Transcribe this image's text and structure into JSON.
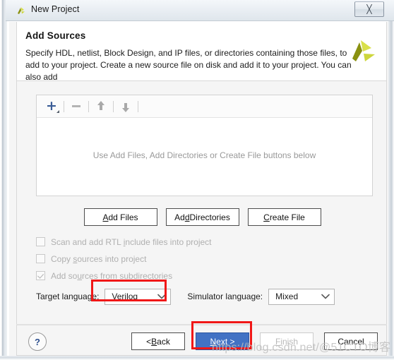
{
  "window": {
    "title": "New Project",
    "icon": "xilinx-logo-icon",
    "close_label": "✕"
  },
  "header": {
    "title": "Add Sources",
    "description": "Specify HDL, netlist, Block Design, and IP files, or directories containing those files, to add to your project. Create a new source file on disk and add it to your project. You can also add",
    "logo": "xilinx-logo"
  },
  "file_panel": {
    "toolbar": {
      "add_label": "+",
      "remove_label": "−",
      "move_up_label": "↑",
      "move_down_label": "↓"
    },
    "empty_message": "Use Add Files, Add Directories or Create File buttons below"
  },
  "action_buttons": [
    {
      "id": "add-files",
      "pre": "",
      "mnemonic": "A",
      "post": "dd Files"
    },
    {
      "id": "add-directories",
      "pre": "Ad",
      "mnemonic": "d",
      "post": " Directories"
    },
    {
      "id": "create-file",
      "pre": "",
      "mnemonic": "C",
      "post": "reate File"
    }
  ],
  "checkboxes": [
    {
      "id": "scan-rtl-include",
      "pre": "Scan and add RTL ",
      "mnemonic": "i",
      "post": "nclude files into project",
      "checked": false,
      "enabled": false
    },
    {
      "id": "copy-sources",
      "pre": "Copy ",
      "mnemonic": "s",
      "post": "ources into project",
      "checked": false,
      "enabled": false
    },
    {
      "id": "add-subdirectories",
      "pre": "Add so",
      "mnemonic": "u",
      "post": "rces from subdirectories",
      "checked": true,
      "enabled": false
    }
  ],
  "languages": {
    "target_label": "Target language:",
    "target_value": "Verilog",
    "simulator_label": "Simulator language:",
    "simulator_value": "Mixed"
  },
  "footer": {
    "help_label": "?",
    "buttons": [
      {
        "id": "back",
        "pre": "< ",
        "mnemonic": "B",
        "post": "ack",
        "style": "normal"
      },
      {
        "id": "next",
        "pre": "",
        "mnemonic": "N",
        "post": "ext >",
        "style": "primary"
      },
      {
        "id": "finish",
        "pre": "",
        "mnemonic": "F",
        "post": "inish",
        "style": "disabled"
      },
      {
        "id": "cancel",
        "pre": "Cancel",
        "mnemonic": "",
        "post": "",
        "style": "normal"
      }
    ]
  },
  "annotations": {
    "color": "#f01717",
    "targets": [
      "target-language-combo",
      "next-button"
    ]
  },
  "watermark": "https://blog.csdn.net/@51CTO博客"
}
